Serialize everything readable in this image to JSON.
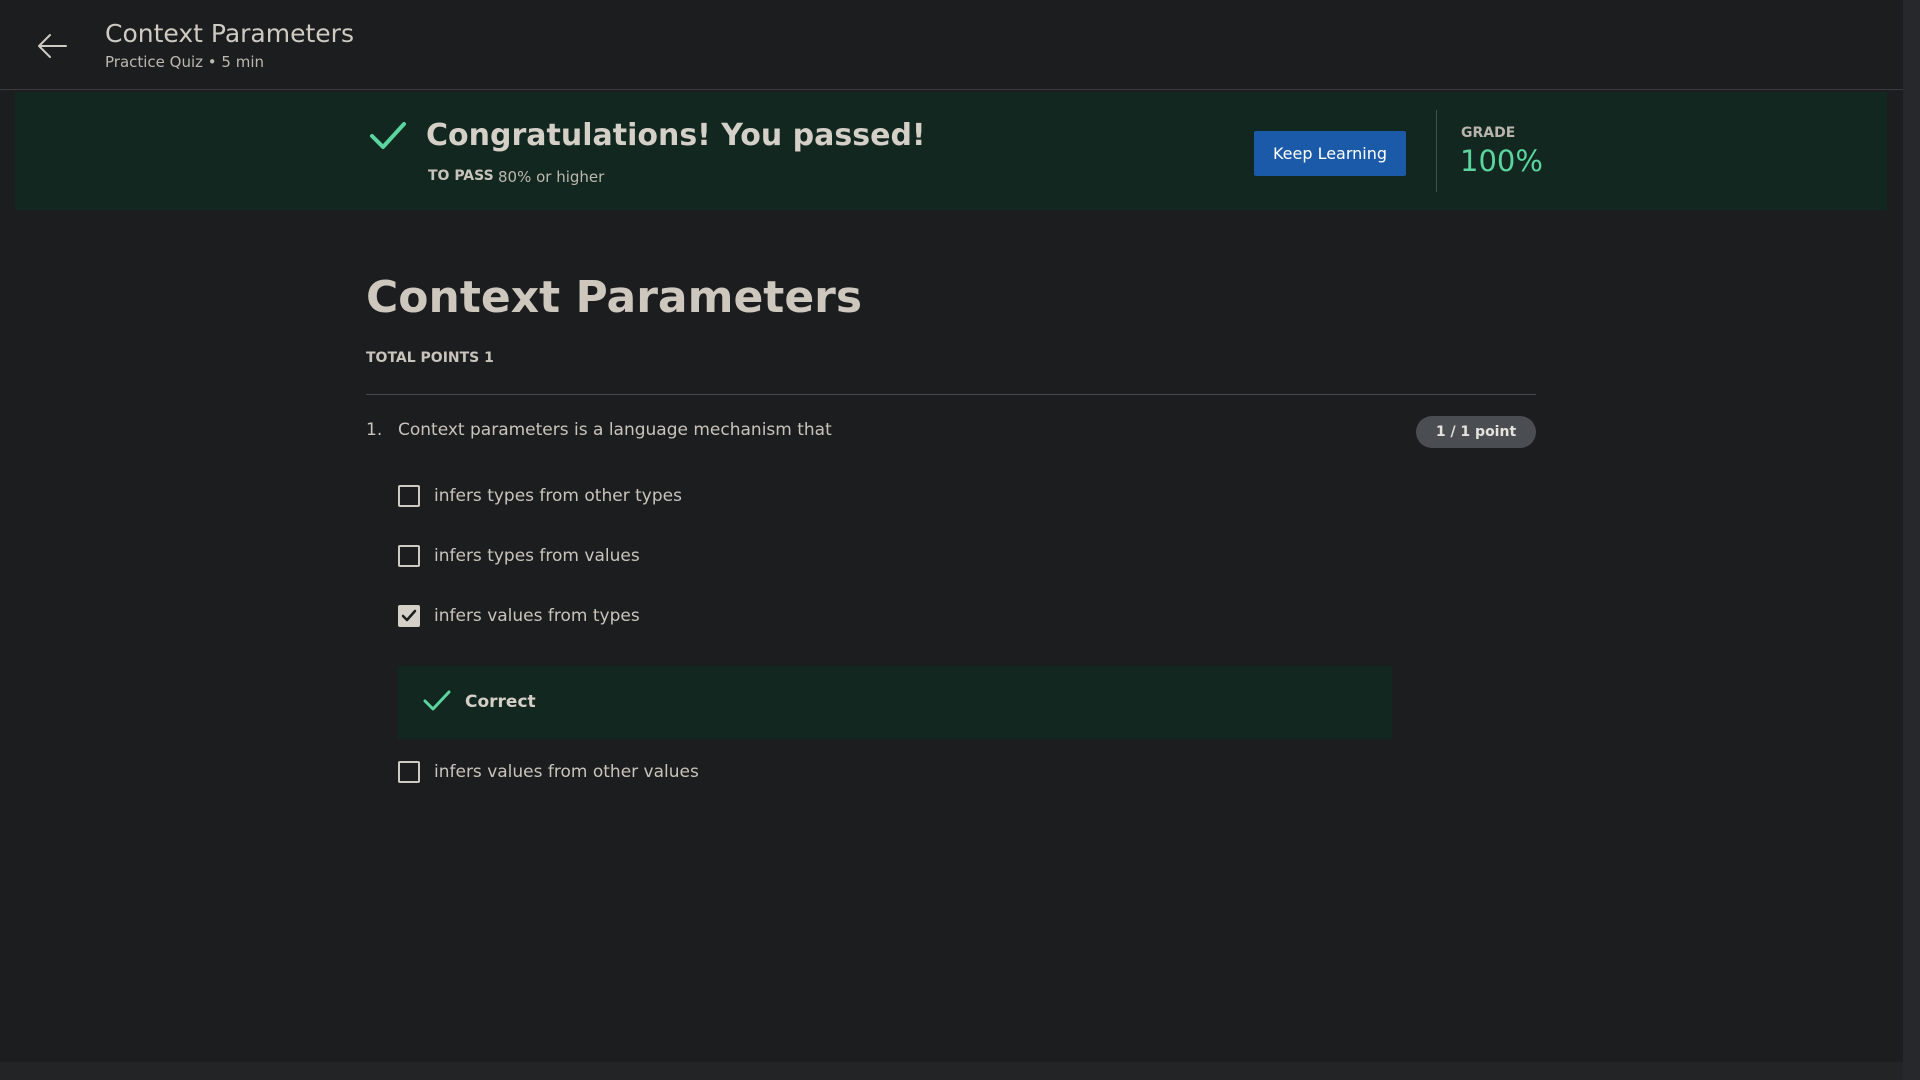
{
  "header": {
    "title": "Context Parameters",
    "subtitle": "Practice Quiz • 5 min",
    "back_icon": "arrow-left-icon"
  },
  "result_banner": {
    "title": "Congratulations! You passed!",
    "to_pass_label": "TO PASS",
    "to_pass_value": "80% or higher",
    "keep_learning_label": "Keep Learning",
    "grade_label": "GRADE",
    "grade_value": "100%",
    "check_icon": "check-icon",
    "accent_color": "#5bd59e",
    "button_color": "#1b5aa8"
  },
  "quiz": {
    "title": "Context Parameters",
    "total_points": "TOTAL POINTS 1",
    "question": {
      "number": "1.",
      "text": "Context parameters is a language mechanism that",
      "score": "1 / 1 point",
      "options": [
        {
          "label": "infers types from other types",
          "checked": false
        },
        {
          "label": "infers types from values",
          "checked": false
        },
        {
          "label": "infers values from types",
          "checked": true
        },
        {
          "label": "infers values from other values",
          "checked": false
        }
      ],
      "feedback": "Correct"
    }
  }
}
